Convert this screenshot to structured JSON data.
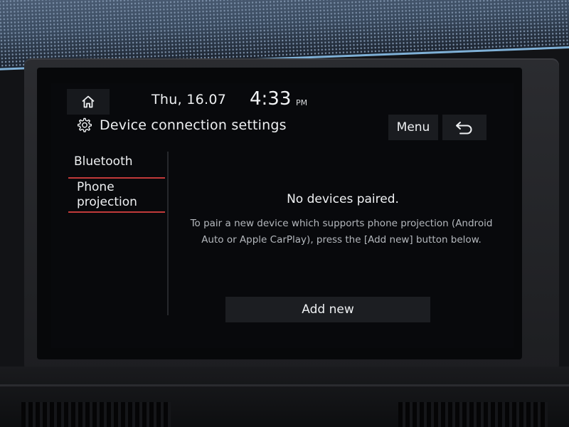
{
  "status_bar": {
    "home_icon": "home-icon",
    "date": "Thu, 16.07",
    "time": "4:33",
    "ampm": "PM"
  },
  "header": {
    "settings_icon": "gear-icon",
    "title": "Device connection settings",
    "menu_label": "Menu",
    "back_icon": "back-arrow-icon"
  },
  "sidebar": {
    "items": [
      {
        "label": "Bluetooth",
        "selected": false
      },
      {
        "label": "Phone projection",
        "selected": true
      }
    ]
  },
  "main": {
    "empty_title": "No devices paired.",
    "description": "To pair a new device which supports phone projection (Android Auto or Apple CarPlay), press the [Add new] button below.",
    "add_button_label": "Add new"
  },
  "colors": {
    "background": "#08090c",
    "text": "#eef0f2",
    "muted_text": "#b4b8bd",
    "selected_accent": "#c23a3a",
    "button_bg": "#1c1e22"
  }
}
